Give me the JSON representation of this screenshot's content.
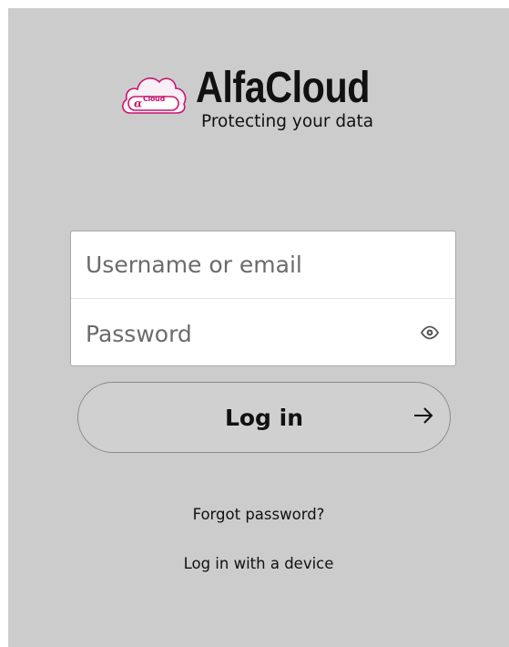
{
  "brand": {
    "logo_badge_text": "Cloud",
    "title": "AlfaCloud",
    "tagline": "Protecting your data",
    "accent_color": "#c9176f"
  },
  "form": {
    "username_placeholder": "Username or email",
    "username_value": "",
    "password_placeholder": "Password",
    "password_value": "",
    "toggle_visibility_icon": "eye-icon"
  },
  "actions": {
    "login_label": "Log in",
    "login_icon": "arrow-right-icon",
    "forgot_password_label": "Forgot password?",
    "device_login_label": "Log in with a device"
  }
}
